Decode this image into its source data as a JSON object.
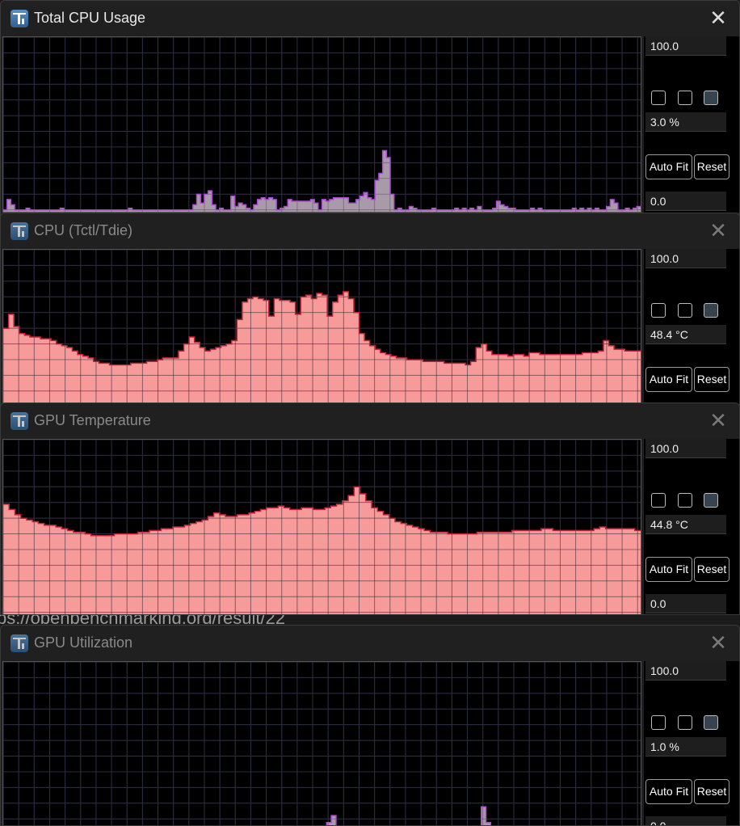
{
  "background_url": "ps://openbenchmarking.org/result/22",
  "buttons": {
    "auto_fit": "Auto Fit",
    "reset": "Reset"
  },
  "windows": [
    {
      "title": "Total CPU Usage",
      "max": "100.0",
      "current": "3.0 %",
      "min": "0.0",
      "fill": "#a99aaa",
      "stroke": "#b04bd8",
      "active": true,
      "mode": "spikes"
    },
    {
      "title": "CPU (Tctl/Tdie)",
      "max": "100.0",
      "current": "48.4 °C",
      "min": "",
      "fill": "#f79b9a",
      "stroke": "#c0253a",
      "active": false,
      "mode": "area"
    },
    {
      "title": "GPU Temperature",
      "max": "100.0",
      "current": "44.8 °C",
      "min": "0.0",
      "fill": "#f79b9a",
      "stroke": "#c0253a",
      "active": false,
      "mode": "area"
    },
    {
      "title": "GPU Utilization",
      "max": "100.0",
      "current": "1.0 %",
      "min": "0.0",
      "fill": "#a99aaa",
      "stroke": "#b04bd8",
      "active": false,
      "mode": "spikes"
    }
  ],
  "chart_data": [
    {
      "type": "area",
      "title": "Total CPU Usage",
      "ylim": [
        0,
        100
      ],
      "grid": true,
      "series": [
        {
          "values": [
            1,
            7,
            4,
            1,
            1,
            1,
            2,
            1,
            1,
            1,
            1,
            1,
            1,
            1,
            1,
            2,
            1,
            1,
            1,
            1,
            1,
            1,
            1,
            1,
            1,
            1,
            1,
            1,
            1,
            1,
            1,
            1,
            1,
            2,
            1,
            1,
            1,
            1,
            1,
            1,
            1,
            1,
            1,
            1,
            1,
            1,
            1,
            1,
            1,
            1,
            4,
            10,
            5,
            10,
            12,
            4,
            1,
            2,
            1,
            1,
            9,
            3,
            5,
            4,
            2,
            1,
            4,
            7,
            8,
            7,
            8,
            7,
            1,
            2,
            3,
            7,
            6,
            6,
            6,
            6,
            6,
            7,
            5,
            1,
            7,
            6,
            7,
            8,
            8,
            8,
            8,
            5,
            5,
            7,
            9,
            11,
            8,
            7,
            18,
            22,
            35,
            31,
            10,
            1,
            2,
            1,
            1,
            3,
            2,
            1,
            1,
            1,
            1,
            2,
            1,
            1,
            1,
            1,
            1,
            2,
            1,
            2,
            1,
            2,
            1,
            3,
            1,
            1,
            1,
            2,
            6,
            4,
            3,
            2,
            2,
            1,
            1,
            1,
            1,
            2,
            1,
            2,
            1,
            1,
            1,
            1,
            1,
            1,
            1,
            1,
            2,
            1,
            2,
            1,
            2,
            1,
            2,
            1,
            1,
            3,
            7,
            5,
            1,
            1,
            2,
            1,
            2,
            3
          ]
        }
      ]
    },
    {
      "type": "area",
      "title": "CPU (Tctl/Tdie)",
      "ylim": [
        0,
        100
      ],
      "grid": true,
      "series": [
        {
          "values": [
            55,
            63,
            56,
            52,
            51,
            50,
            50,
            49,
            49,
            48,
            46,
            45,
            44,
            42,
            40,
            39,
            38,
            36,
            35,
            35,
            34,
            34,
            34,
            34,
            35,
            35,
            35,
            36,
            36,
            37,
            38,
            38,
            38,
            42,
            46,
            50,
            47,
            44,
            42,
            43,
            44,
            45,
            46,
            48,
            60,
            70,
            72,
            73,
            72,
            71,
            62,
            72,
            71,
            71,
            70,
            63,
            73,
            74,
            72,
            75,
            74,
            62,
            70,
            74,
            76,
            72,
            64,
            52,
            48,
            45,
            43,
            41,
            40,
            39,
            38,
            38,
            37,
            37,
            37,
            36,
            36,
            36,
            36,
            35,
            35,
            35,
            35,
            34,
            36,
            44,
            46,
            42,
            40,
            40,
            40,
            39,
            40,
            40,
            39,
            41,
            41,
            40,
            40,
            40,
            40,
            40,
            40,
            40,
            40,
            41,
            41,
            41,
            42,
            48,
            45,
            43,
            43,
            42,
            42,
            42
          ]
        }
      ]
    },
    {
      "type": "area",
      "title": "GPU Temperature",
      "ylim": [
        0,
        100
      ],
      "grid": true,
      "series": [
        {
          "values": [
            63,
            60,
            57,
            55,
            54,
            53,
            52,
            51,
            51,
            50,
            49,
            48,
            47,
            47,
            46,
            45,
            45,
            45,
            45,
            46,
            46,
            46,
            46,
            47,
            47,
            48,
            48,
            49,
            49,
            50,
            50,
            51,
            52,
            53,
            54,
            56,
            58,
            57,
            56,
            56,
            57,
            57,
            58,
            59,
            60,
            61,
            61,
            62,
            61,
            60,
            60,
            61,
            61,
            60,
            60,
            61,
            62,
            63,
            65,
            68,
            73,
            69,
            65,
            61,
            59,
            57,
            55,
            53,
            52,
            51,
            50,
            49,
            48,
            47,
            47,
            47,
            46,
            46,
            46,
            46,
            46,
            47,
            47,
            47,
            47,
            47,
            47,
            48,
            48,
            48,
            48,
            48,
            49,
            49,
            48,
            48,
            48,
            48,
            48,
            48,
            48,
            49,
            50,
            49,
            49,
            49,
            49,
            49,
            48
          ]
        }
      ]
    },
    {
      "type": "area",
      "title": "GPU Utilization",
      "ylim": [
        0,
        100
      ],
      "grid": true,
      "series": [
        {
          "values": [
            1,
            1,
            1,
            1,
            1,
            1,
            1,
            1,
            1,
            1,
            1,
            1,
            1,
            1,
            1,
            1,
            1,
            1,
            1,
            1,
            1,
            1,
            1,
            1,
            1,
            1,
            1,
            1,
            1,
            1,
            1,
            1,
            1,
            1,
            1,
            1,
            1,
            1,
            1,
            1,
            1,
            1,
            1,
            1,
            1,
            1,
            1,
            1,
            1,
            1,
            1,
            1,
            1,
            1,
            1,
            1,
            1,
            1,
            1,
            1,
            1,
            1,
            1,
            1,
            1,
            1,
            1,
            1,
            5,
            8,
            12,
            6,
            1,
            1,
            1,
            1,
            1,
            1,
            1,
            1,
            1,
            1,
            1,
            1,
            1,
            1,
            1,
            1,
            1,
            1,
            1,
            1,
            1,
            1,
            1,
            1,
            1,
            1,
            1,
            1,
            1,
            1,
            17,
            8,
            4,
            1,
            1,
            1,
            1,
            1,
            1,
            1,
            1,
            1,
            1,
            1,
            3,
            1,
            1,
            2,
            1,
            4,
            2,
            1,
            2,
            3,
            1,
            1,
            2,
            1,
            2,
            3,
            1,
            2,
            4,
            1
          ]
        }
      ]
    }
  ]
}
